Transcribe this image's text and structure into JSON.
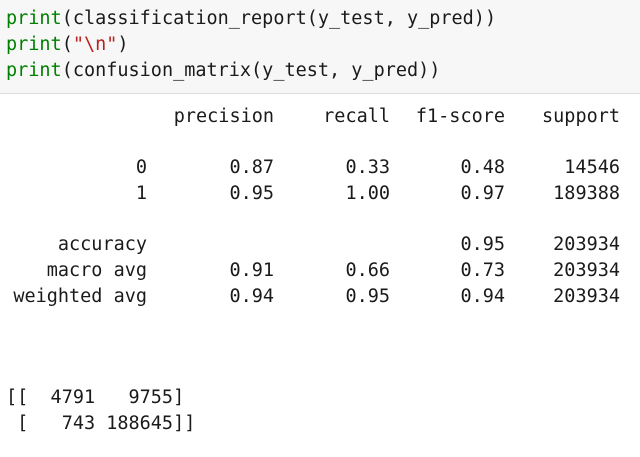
{
  "code": {
    "lines": [
      {
        "fn": "print",
        "args": "(classification_report(y_test, y_pred))"
      },
      {
        "fn": "print",
        "open": "(",
        "str": "\"\\n\"",
        "close": ")"
      },
      {
        "fn": "print",
        "args": "(confusion_matrix(y_test, y_pred))"
      }
    ]
  },
  "report": {
    "headers": [
      "precision",
      "recall",
      "f1-score",
      "support"
    ],
    "rows": [
      {
        "label": "0",
        "precision": "0.87",
        "recall": "0.33",
        "f1": "0.48",
        "support": "14546"
      },
      {
        "label": "1",
        "precision": "0.95",
        "recall": "1.00",
        "f1": "0.97",
        "support": "189388"
      },
      {
        "label": "accuracy",
        "precision": "",
        "recall": "",
        "f1": "0.95",
        "support": "203934"
      },
      {
        "label": "macro avg",
        "precision": "0.91",
        "recall": "0.66",
        "f1": "0.73",
        "support": "203934"
      },
      {
        "label": "weighted avg",
        "precision": "0.94",
        "recall": "0.95",
        "f1": "0.94",
        "support": "203934"
      }
    ]
  },
  "matrix": {
    "line1": "[[  4791   9755]",
    "line2": " [   743 188645]]"
  }
}
